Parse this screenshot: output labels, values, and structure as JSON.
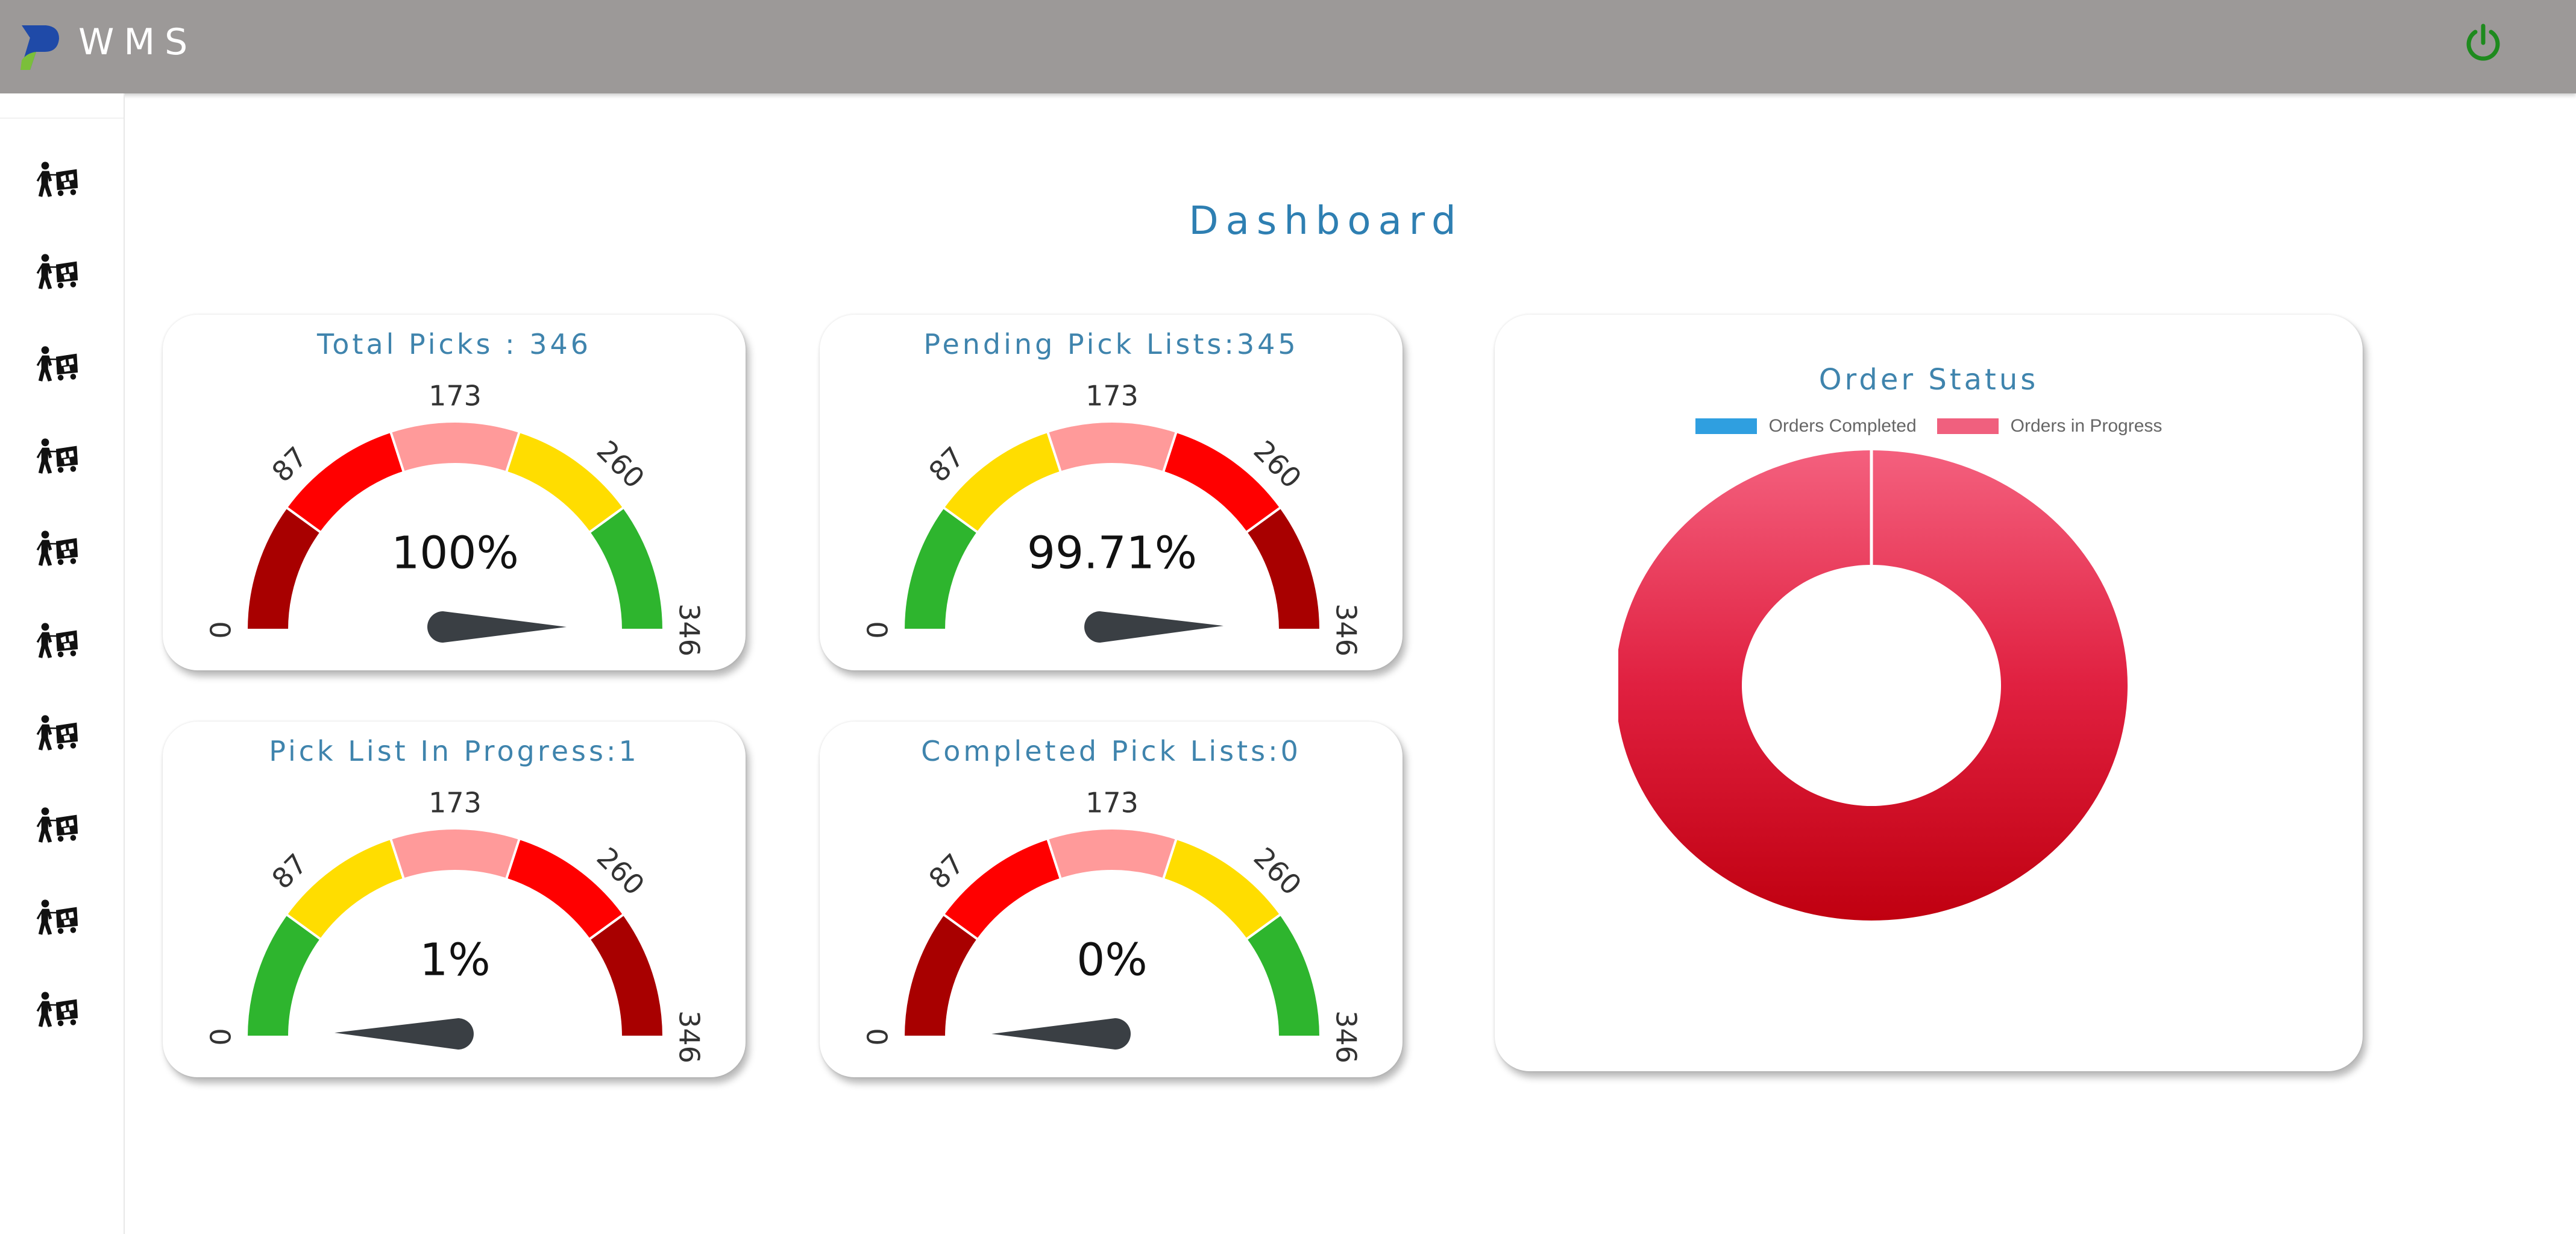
{
  "header": {
    "app_name": "WMS",
    "logo_icon": "p-logo-icon",
    "power_icon": "power-icon",
    "power_color": "#1e8a1e"
  },
  "sidebar": {
    "items": [
      {
        "icon": "worker-pushing-cart-icon"
      },
      {
        "icon": "worker-pushing-cart-icon"
      },
      {
        "icon": "worker-pushing-cart-icon"
      },
      {
        "icon": "worker-pushing-cart-icon"
      },
      {
        "icon": "worker-pushing-cart-icon"
      },
      {
        "icon": "worker-pushing-cart-icon"
      },
      {
        "icon": "worker-pushing-cart-icon"
      },
      {
        "icon": "worker-pushing-cart-icon"
      },
      {
        "icon": "worker-pushing-cart-icon"
      },
      {
        "icon": "worker-pushing-cart-icon"
      }
    ]
  },
  "page": {
    "title": "Dashboard"
  },
  "gauges": [
    {
      "title": "Total Picks : 346",
      "value_label": "100%",
      "value": 346,
      "min": 0,
      "max": 346,
      "ticks": [
        "0",
        "87",
        "173",
        "260",
        "346"
      ],
      "bands": [
        "#a80000",
        "#ff0000",
        "#ff9a9a",
        "#ffdd00",
        "#2eb52e"
      ]
    },
    {
      "title": "Pending Pick Lists:345",
      "value_label": "99.71%",
      "value": 345,
      "min": 0,
      "max": 346,
      "ticks": [
        "0",
        "87",
        "173",
        "260",
        "346"
      ],
      "bands": [
        "#2eb52e",
        "#ffdd00",
        "#ff9a9a",
        "#ff0000",
        "#a80000"
      ]
    },
    {
      "title": "Pick List In Progress:1",
      "value_label": "1%",
      "value": 1,
      "min": 0,
      "max": 346,
      "ticks": [
        "0",
        "87",
        "173",
        "260",
        "346"
      ],
      "bands": [
        "#2eb52e",
        "#ffdd00",
        "#ff9a9a",
        "#ff0000",
        "#a80000"
      ]
    },
    {
      "title": "Completed Pick Lists:0",
      "value_label": "0%",
      "value": 0,
      "min": 0,
      "max": 346,
      "ticks": [
        "0",
        "87",
        "173",
        "260",
        "346"
      ],
      "bands": [
        "#a80000",
        "#ff0000",
        "#ff9a9a",
        "#ffdd00",
        "#2eb52e"
      ]
    }
  ],
  "order_status": {
    "title": "Order Status",
    "legend": [
      {
        "label": "Orders Completed",
        "color": "#2f9fe0"
      },
      {
        "label": "Orders in Progress",
        "color": "#f0607e"
      }
    ]
  },
  "chart_data": {
    "type": "pie",
    "title": "Order Status",
    "categories": [
      "Orders Completed",
      "Orders in Progress"
    ],
    "values": [
      0,
      1
    ],
    "colors": [
      "#2f9fe0",
      "#f0607e"
    ],
    "legend": "top"
  }
}
